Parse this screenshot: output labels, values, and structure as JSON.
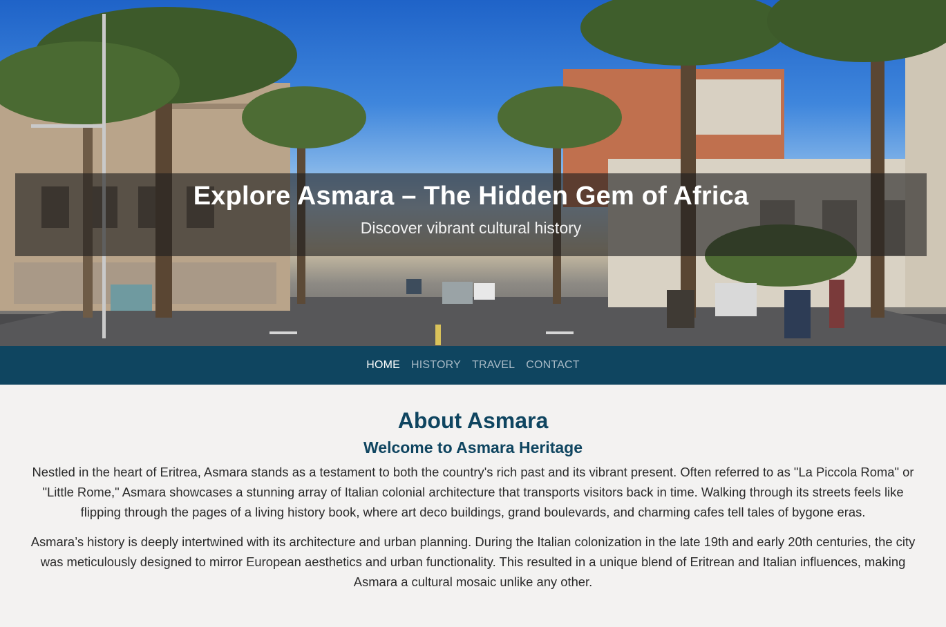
{
  "hero": {
    "title": "Explore Asmara – The Hidden Gem of Africa",
    "subtitle": "Discover vibrant cultural history"
  },
  "nav": {
    "items": [
      {
        "label": "HOME",
        "active": true
      },
      {
        "label": "HISTORY",
        "active": false
      },
      {
        "label": "TRAVEL",
        "active": false
      },
      {
        "label": "CONTACT",
        "active": false
      }
    ]
  },
  "about": {
    "title": "About Asmara",
    "subtitle": "Welcome to Asmara Heritage",
    "paragraphs": [
      "Nestled in the heart of Eritrea, Asmara stands as a testament to both the country's rich past and its vibrant present. Often referred to as \"La Piccola Roma\" or \"Little Rome,\" Asmara showcases a stunning array of Italian colonial architecture that transports visitors back in time. Walking through its streets feels like flipping through the pages of a living history book, where art deco buildings, grand boulevards, and charming cafes tell tales of bygone eras.",
      "Asmara’s history is deeply intertwined with its architecture and urban planning. During the Italian colonization in the late 19th and early 20th centuries, the city was meticulously designed to mirror European aesthetics and urban functionality. This resulted in a unique blend of Eritrean and Italian influences, making Asmara a cultural mosaic unlike any other."
    ]
  },
  "colors": {
    "navbar": "#0f4560",
    "heading": "#0f4560",
    "background": "#f3f2f1"
  }
}
